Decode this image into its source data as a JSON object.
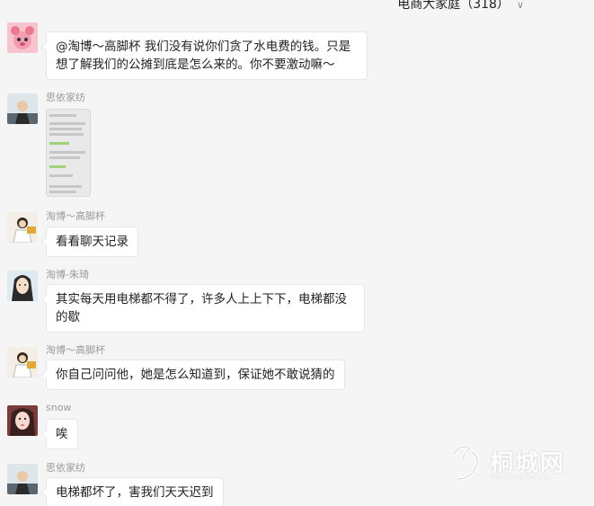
{
  "header": {
    "group_name": "电商大家庭（318）"
  },
  "messages": [
    {
      "sender": "",
      "text": "@淘博～高脚杯 我们没有说你们贪了水电费的钱。只是想了解我们的公摊到底是怎么来的。你不要激动嘛～"
    },
    {
      "sender": "思依家纺",
      "text": ""
    },
    {
      "sender": "淘博～高脚杯",
      "text": "看看聊天记录"
    },
    {
      "sender": "淘博-朱琦",
      "text": "其实每天用电梯都不得了，许多人上上下下，电梯都没的歇"
    },
    {
      "sender": "淘博～高脚杯",
      "text": "你自己问问他，她是怎么知道到，保证她不敢说猜的"
    },
    {
      "sender": "snow",
      "text": "唉"
    },
    {
      "sender": "思依家纺",
      "text": "电梯都坏了，害我们天天迟到"
    }
  ],
  "watermark": {
    "name": "桐城网",
    "url": "www.tongcheng.cc"
  },
  "colors": {
    "background": "#f5f5f5",
    "bubble": "#ffffff",
    "sender": "#9a9a9a"
  }
}
